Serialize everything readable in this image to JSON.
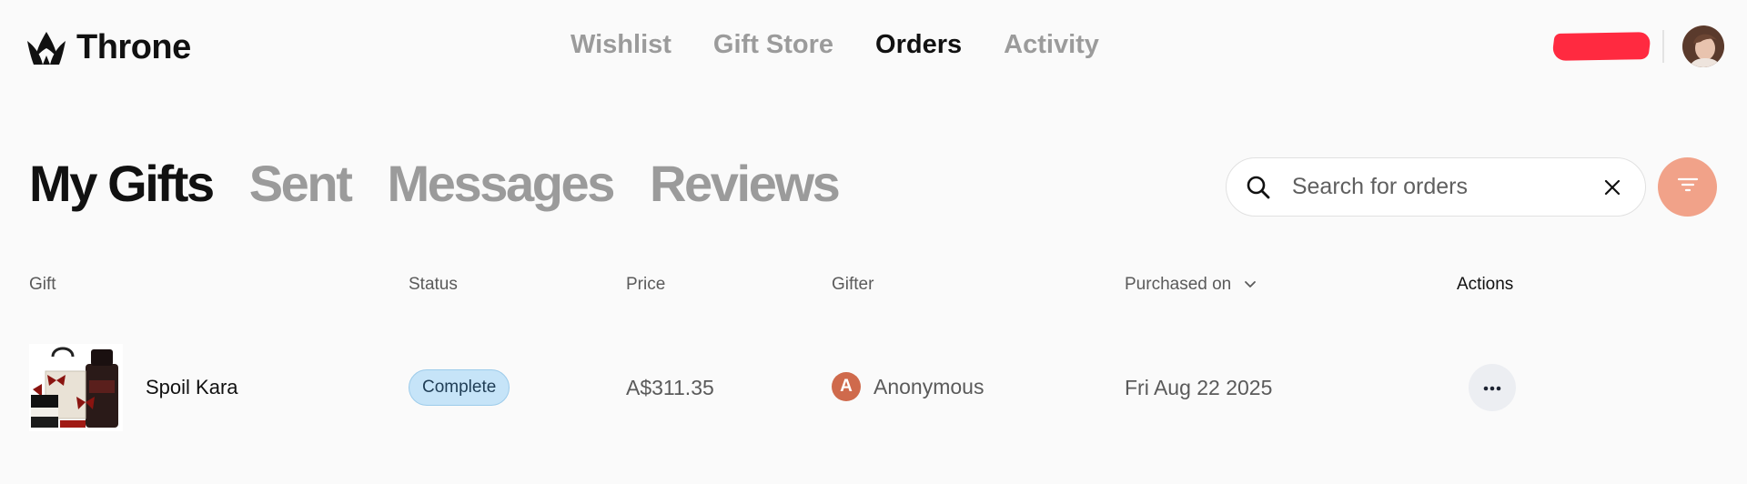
{
  "header": {
    "brand": "Throne",
    "nav": [
      {
        "label": "Wishlist",
        "active": false
      },
      {
        "label": "Gift Store",
        "active": false
      },
      {
        "label": "Orders",
        "active": true
      },
      {
        "label": "Activity",
        "active": false
      }
    ]
  },
  "tabs": [
    {
      "label": "My Gifts",
      "active": true
    },
    {
      "label": "Sent",
      "active": false
    },
    {
      "label": "Messages",
      "active": false
    },
    {
      "label": "Reviews",
      "active": false
    }
  ],
  "search": {
    "placeholder": "Search for orders",
    "value": ""
  },
  "table": {
    "columns": {
      "gift": "Gift",
      "status": "Status",
      "price": "Price",
      "gifter": "Gifter",
      "purchased_on": "Purchased on",
      "actions": "Actions"
    },
    "rows": [
      {
        "gift": "Spoil Kara",
        "status": "Complete",
        "price": "A$311.35",
        "gifter_initial": "A",
        "gifter": "Anonymous",
        "purchased_on": "Fri Aug 22 2025"
      }
    ]
  },
  "colors": {
    "accent": "#f1a289",
    "status_complete_bg": "#c6e4f8",
    "gifter_avatar": "#cf6a4c",
    "redaction": "#ff2a40"
  },
  "icons": {
    "brand": "crown-logo-icon",
    "search": "search-icon",
    "clear": "close-icon",
    "filter": "filter-icon",
    "sort": "chevron-down-icon",
    "actions": "more-horizontal-icon"
  }
}
